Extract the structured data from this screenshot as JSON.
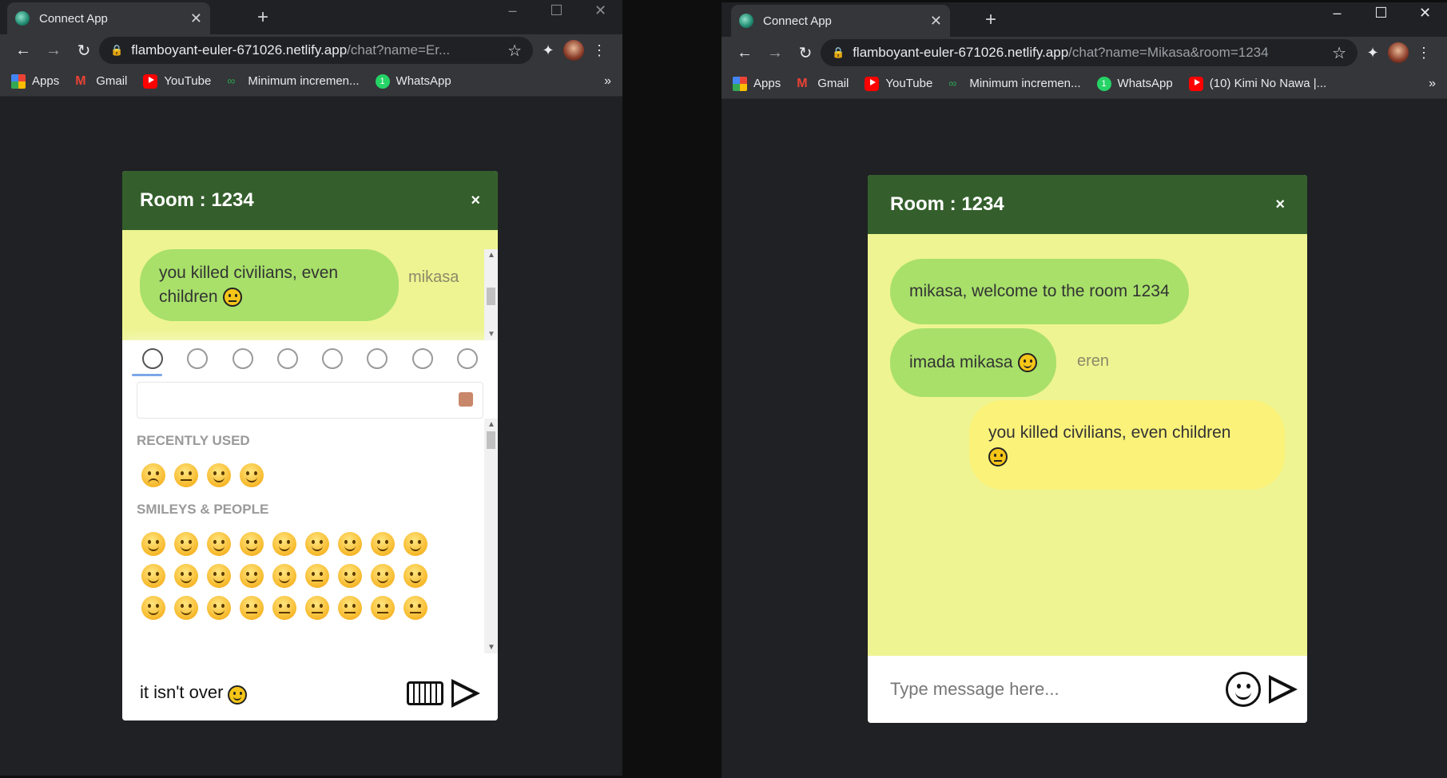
{
  "left_window": {
    "tab_title": "Connect App",
    "url_host": "flamboyant-euler-671026.netlify.app",
    "url_path": "/chat?name=Er...",
    "bookmarks": [
      "Apps",
      "Gmail",
      "YouTube",
      "Minimum incremen...",
      "WhatsApp"
    ],
    "bookmarks_more": "»",
    "chat": {
      "title": "Room : 1234",
      "close": "×",
      "messages": [
        {
          "text": "you killed civilians, even children",
          "sender": "mikasa"
        }
      ],
      "emoji_picker": {
        "recent_label": "RECENTLY USED",
        "smileys_label": "SMILEYS & PEOPLE"
      },
      "composer_text": "it isn't over"
    }
  },
  "right_window": {
    "tab_title": "Connect App",
    "url_host": "flamboyant-euler-671026.netlify.app",
    "url_path": "/chat?name=Mikasa&room=1234",
    "bookmarks": [
      "Apps",
      "Gmail",
      "YouTube",
      "Minimum incremen...",
      "WhatsApp",
      "(10) Kimi No Nawa |..."
    ],
    "bookmarks_more": "»",
    "chat": {
      "title": "Room : 1234",
      "close": "×",
      "messages": [
        {
          "text": "mikasa, welcome to the room 1234"
        },
        {
          "text": "imada mikasa",
          "sender": "eren"
        },
        {
          "text": "you killed civilians, even children"
        }
      ],
      "composer_placeholder": "Type message here..."
    }
  }
}
